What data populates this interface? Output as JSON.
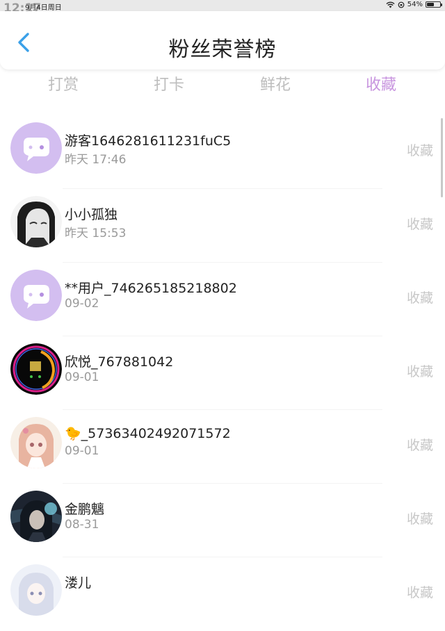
{
  "status_bar": {
    "time": "12:17",
    "date": "9月4日周日",
    "battery": "54%",
    "battery_level": 0.54
  },
  "header": {
    "title": "粉丝荣誉榜"
  },
  "tabs": [
    {
      "label": "打赏",
      "active": false
    },
    {
      "label": "打卡",
      "active": false
    },
    {
      "label": "鲜花",
      "active": false
    },
    {
      "label": "收藏",
      "active": true
    }
  ],
  "fans": [
    {
      "name": "游客1646281611231fuC5",
      "time": "昨天 17:46",
      "action": "收藏",
      "avatar": "default-chat-avatar"
    },
    {
      "name": "小小孤独",
      "time": "昨天 15:53",
      "action": "收藏",
      "avatar": "anime-girl-bw-avatar"
    },
    {
      "name": "**用户_746265185218802",
      "time": "09-02",
      "action": "收藏",
      "avatar": "default-chat-avatar"
    },
    {
      "name": "欣悦_767881042",
      "time": "09-01",
      "action": "收藏",
      "avatar": "neon-ring-avatar"
    },
    {
      "name": "🐤_57363402492071572",
      "time": "09-01",
      "action": "收藏",
      "avatar": "anime-girl-pink-avatar"
    },
    {
      "name": "金鹏魑",
      "time": "08-31",
      "action": "收藏",
      "avatar": "dark-anime-avatar"
    },
    {
      "name": "溇儿",
      "time": "",
      "action": "收藏",
      "avatar": "anime-white-avatar"
    }
  ],
  "colors": {
    "accent": "#c895df",
    "back_arrow": "#3aa0e8",
    "default_avatar": "#d3bef0"
  }
}
